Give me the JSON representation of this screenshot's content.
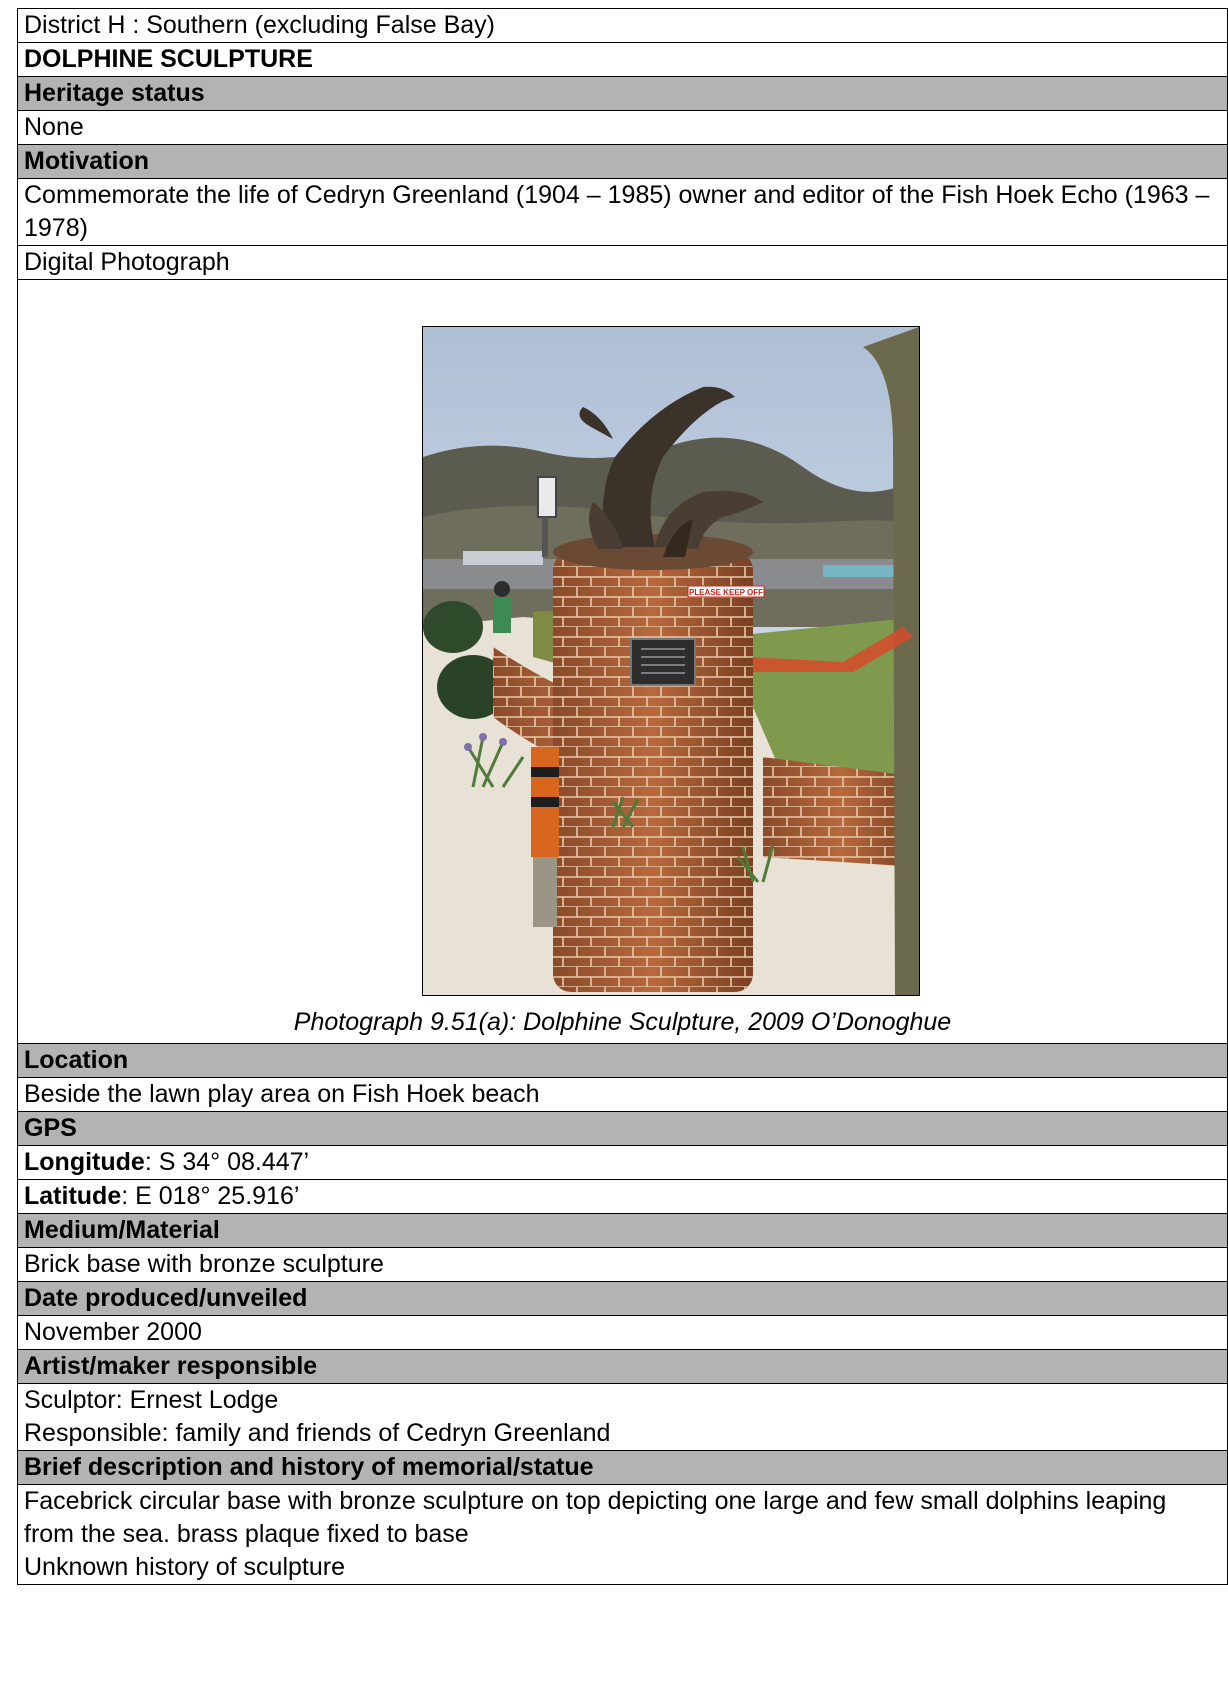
{
  "district": "District H : Southern (excluding False Bay)",
  "title": "DOLPHINE SCULPTURE",
  "heritage": {
    "label": "Heritage status",
    "value": "None"
  },
  "motivation": {
    "label": "Motivation",
    "value": "Commemorate the life of Cedryn Greenland (1904 – 1985) owner and editor of the Fish Hoek Echo (1963 – 1978)"
  },
  "photo": {
    "label": "Digital Photograph",
    "caption": "Photograph 9.51(a): Dolphine Sculpture, 2009 O’Donoghue",
    "sign_text": "PLEASE KEEP OFF"
  },
  "location": {
    "label": "Location",
    "value": "Beside the lawn play area on Fish Hoek beach"
  },
  "gps": {
    "label": "GPS",
    "longitude_label": "Longitude",
    "longitude_value": ": S 34° 08.447’",
    "latitude_label": "Latitude",
    "latitude_value": ": E 018° 25.916’"
  },
  "medium": {
    "label": "Medium/Material",
    "value": "Brick base with bronze sculpture"
  },
  "date": {
    "label": "Date produced/unveiled",
    "value": "November 2000"
  },
  "artist": {
    "label": "Artist/maker responsible",
    "sculptor": "Sculptor: Ernest Lodge",
    "responsible": "Responsible: family and friends of Cedryn Greenland"
  },
  "description": {
    "label": "Brief description and history of memorial/statue",
    "line1": "Facebrick circular base with bronze sculpture on top depicting one large and few small dolphins leaping from the sea.  brass plaque fixed to base",
    "line2": "Unknown history of sculpture"
  }
}
